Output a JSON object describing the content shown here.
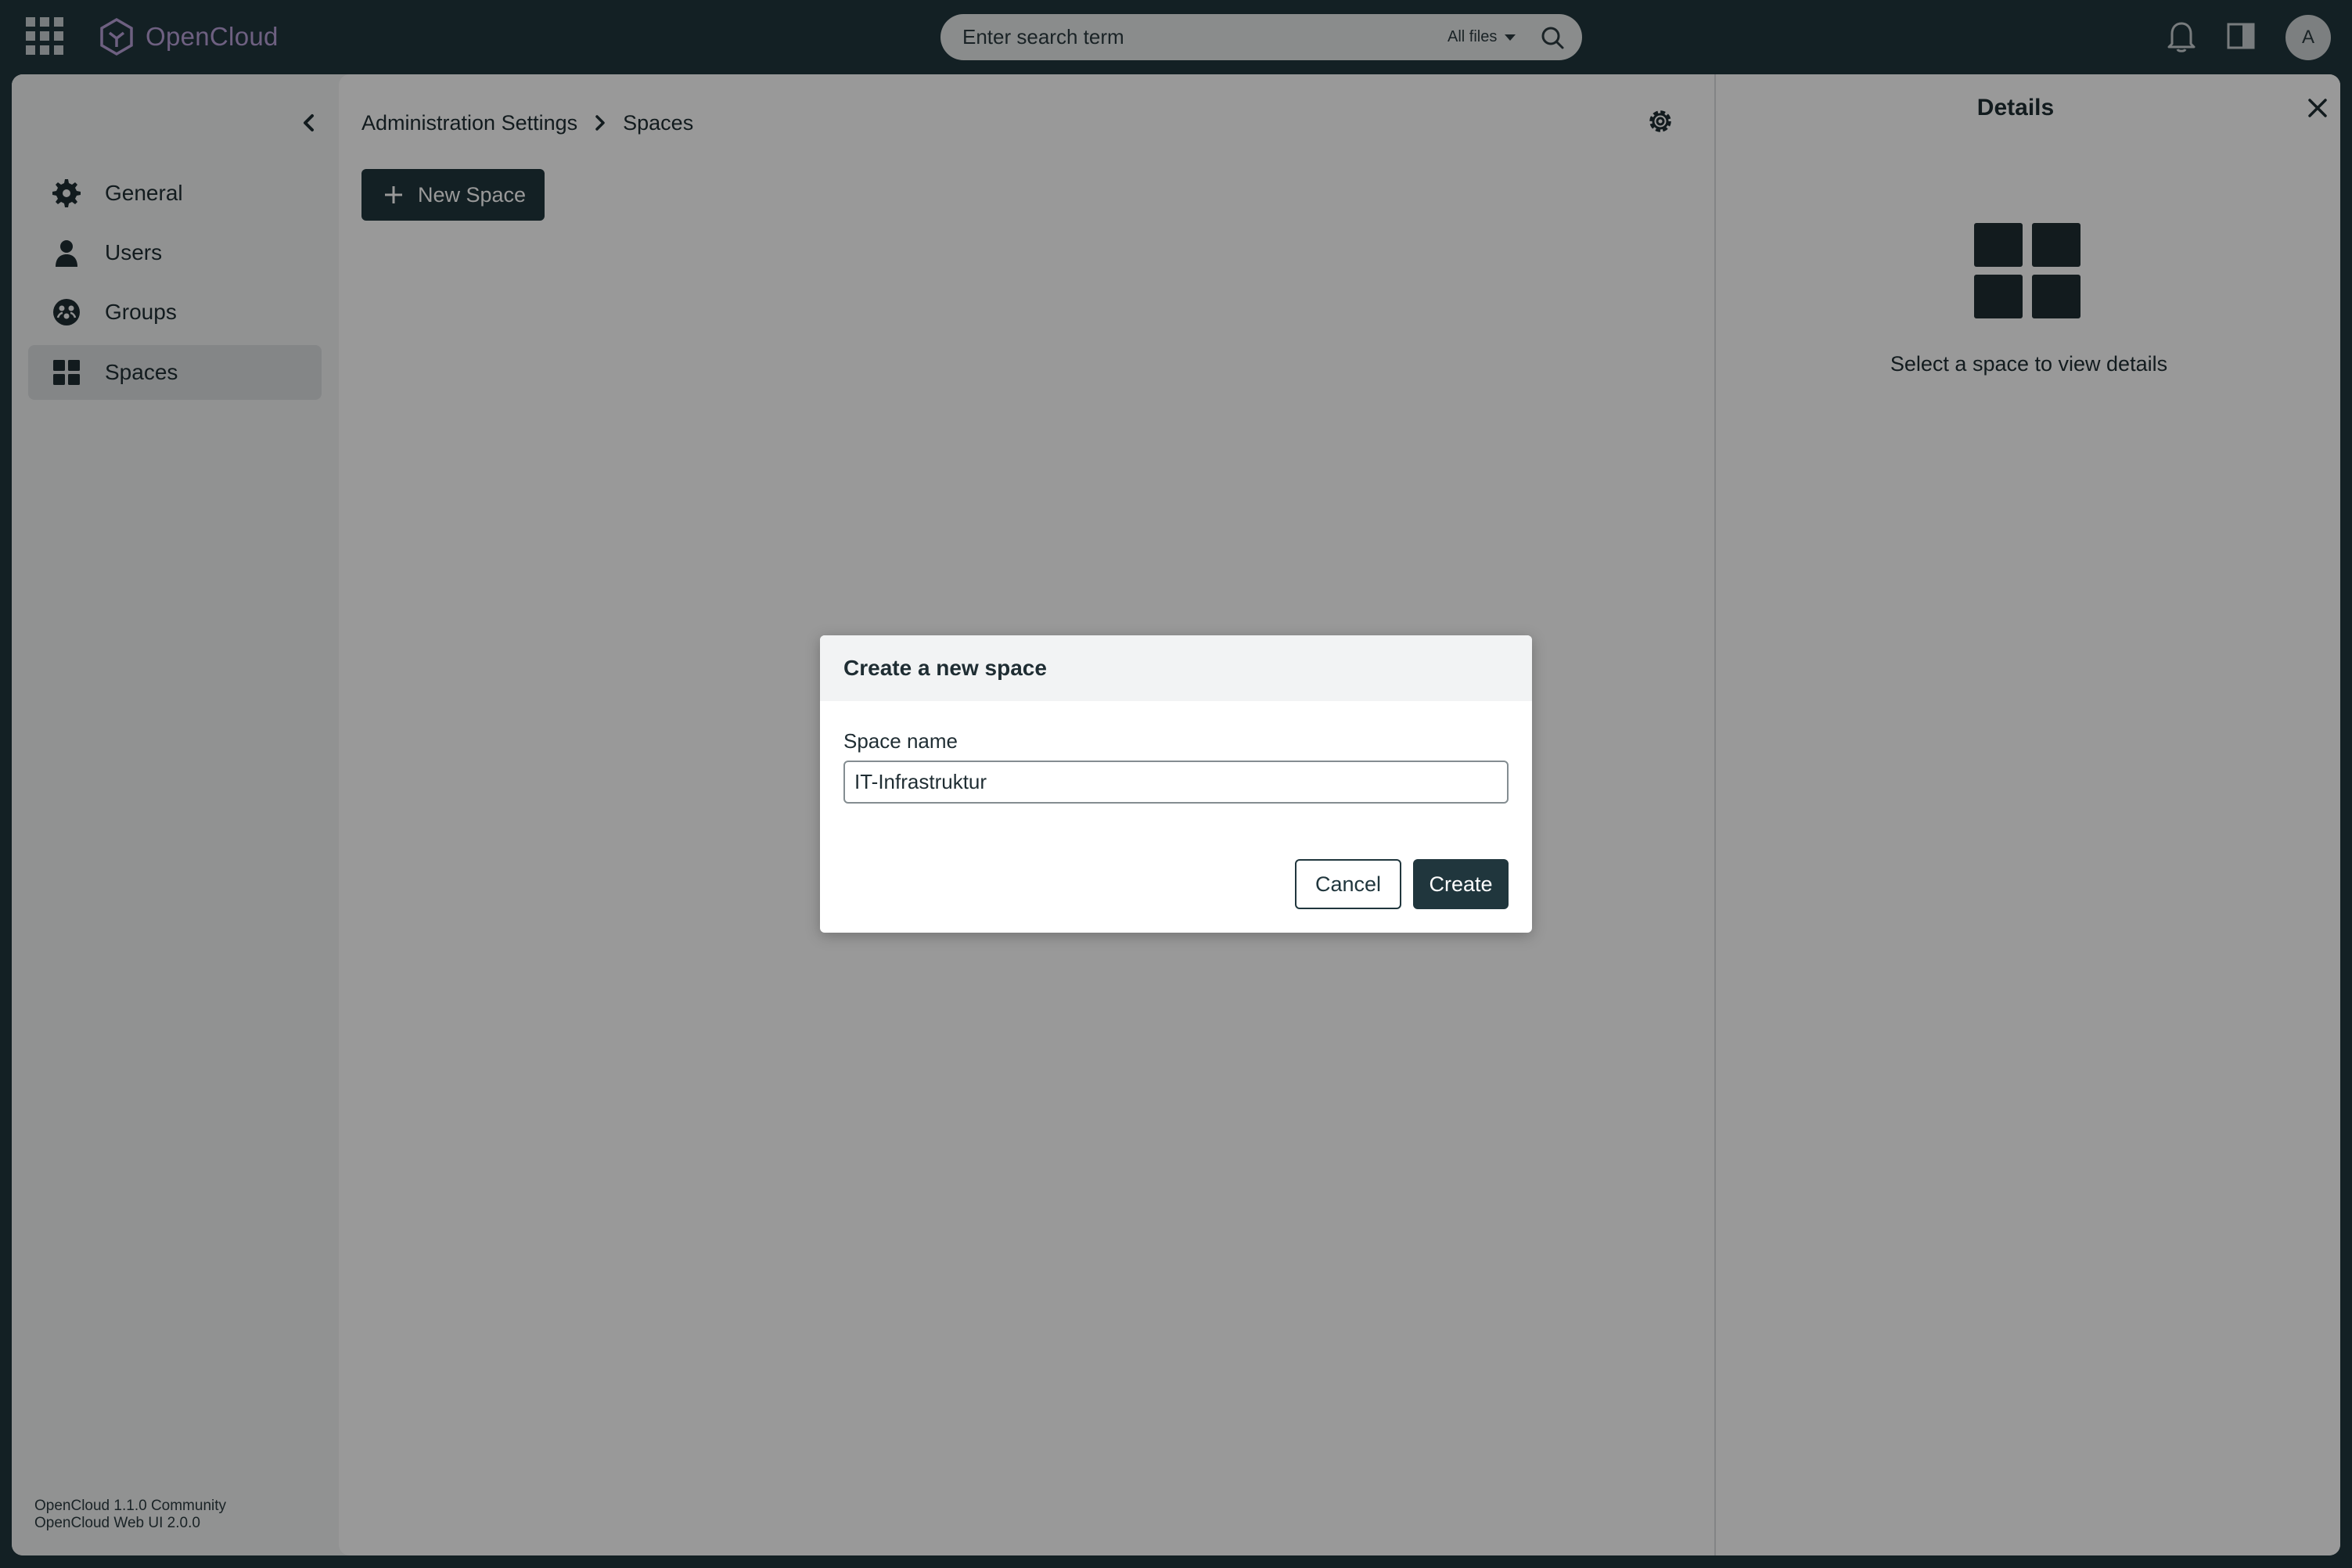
{
  "topbar": {
    "apps_icon": "grid-apps-icon",
    "logo_text": "OpenCloud",
    "search_placeholder": "Enter search term",
    "search_filter": "All files",
    "avatar_initial": "A"
  },
  "sidebar": {
    "items": [
      {
        "label": "General",
        "icon": "gear-icon"
      },
      {
        "label": "Users",
        "icon": "user-icon"
      },
      {
        "label": "Groups",
        "icon": "groups-icon"
      },
      {
        "label": "Spaces",
        "icon": "spaces-icon",
        "active": true
      }
    ],
    "version_line1": "OpenCloud 1.1.0 Community",
    "version_line2": "OpenCloud Web UI 2.0.0"
  },
  "main": {
    "breadcrumb": [
      "Administration Settings",
      "Spaces"
    ],
    "new_space_label": "New Space"
  },
  "details": {
    "title": "Details",
    "empty_text": "Select a space to view details"
  },
  "modal": {
    "title": "Create a new space",
    "field_label": "Space name",
    "field_value": "IT-Infrastruktur",
    "cancel_label": "Cancel",
    "create_label": "Create"
  },
  "colors": {
    "brand_dark": "#20363d",
    "logo_purple": "#b7a1d8",
    "overlay": "rgba(0,0,0,0.4)"
  }
}
